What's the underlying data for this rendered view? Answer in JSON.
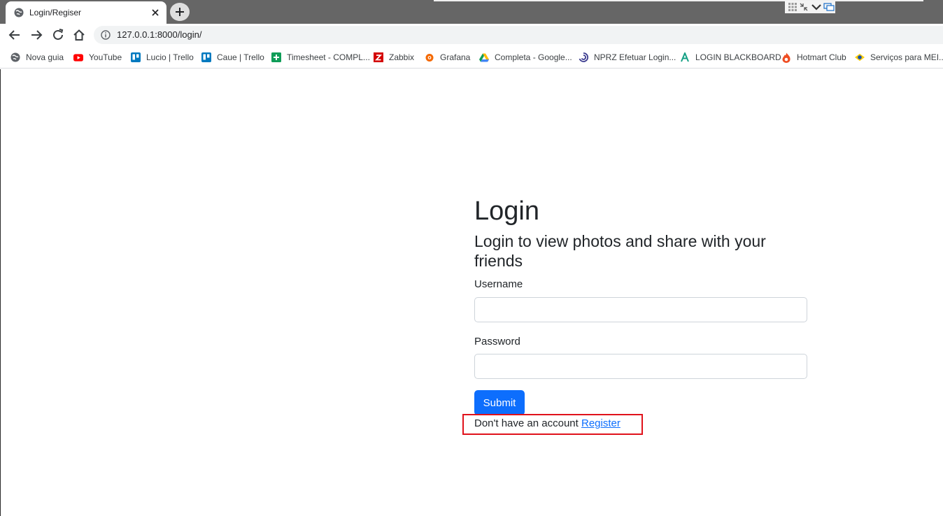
{
  "browser": {
    "tab": {
      "title": "Login/Regiser"
    },
    "address": {
      "url": "127.0.0.1:8000/login/"
    },
    "bookmarks": [
      {
        "label": "Nova guia",
        "icon": "globe-icon",
        "color": "#5f6368"
      },
      {
        "label": "YouTube",
        "icon": "youtube-icon",
        "color": "#ff0000"
      },
      {
        "label": "Lucio | Trello",
        "icon": "trello-icon",
        "color": "#0079bf"
      },
      {
        "label": "Caue | Trello",
        "icon": "trello-icon",
        "color": "#0079bf"
      },
      {
        "label": "Timesheet - COMPL...",
        "icon": "sheets-icon",
        "color": "#0f9d58"
      },
      {
        "label": "Zabbix",
        "icon": "zabbix-icon",
        "color": "#d40000"
      },
      {
        "label": "Grafana",
        "icon": "grafana-icon",
        "color": "#f46800"
      },
      {
        "label": "Completa - Google...",
        "icon": "drive-icon",
        "color": "#1fa463"
      },
      {
        "label": "NPRZ Efetuar Login...",
        "icon": "swirl-icon",
        "color": "#3b3b8f"
      },
      {
        "label": "LOGIN BLACKBOARD",
        "icon": "blackboard-icon",
        "color": "#16a085"
      },
      {
        "label": "Hotmart Club",
        "icon": "hotmart-icon",
        "color": "#ef4e23"
      },
      {
        "label": "Serviços para MEI...",
        "icon": "gov-icon",
        "color": "#1351b4"
      }
    ]
  },
  "login": {
    "title": "Login",
    "subtitle": "Login to view photos and share with your friends",
    "username_label": "Username",
    "username_value": "",
    "password_label": "Password",
    "password_value": "",
    "submit_label": "Submit",
    "register_prompt": "Don't have an account",
    "register_link": "Register"
  },
  "colors": {
    "primary": "#0d6efd",
    "highlight": "#e0121b",
    "tabstrip": "#666666"
  }
}
